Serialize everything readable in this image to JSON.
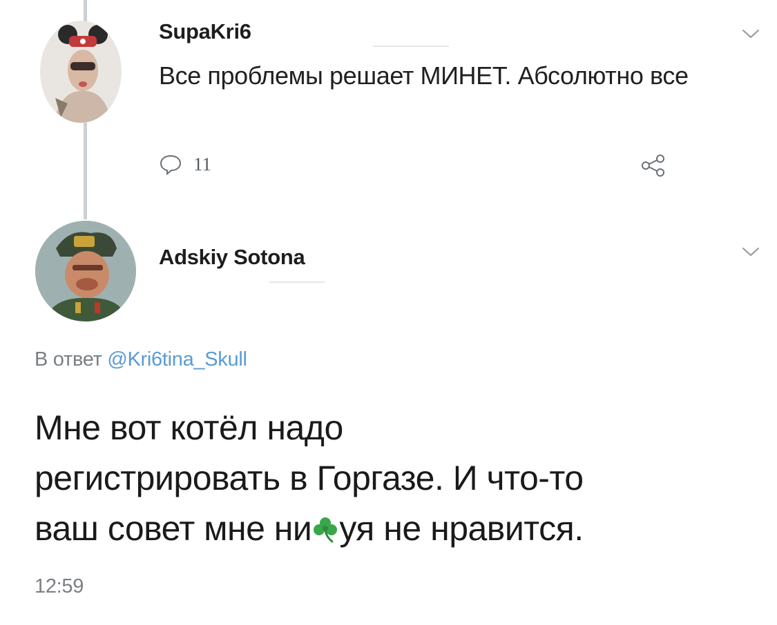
{
  "thread": {
    "parent": {
      "username": "SupaKri6",
      "text": "Все проблемы решает МИНЕТ. Абсолютно все",
      "reply_count": "11",
      "icons": {
        "reply": "reply-bubble-icon",
        "share": "share-icon",
        "menu": "chevron-down-icon"
      }
    },
    "reply": {
      "username": "Adskiy Sotona",
      "reply_prefix": "В ответ ",
      "reply_handle": "@Kri6tina_Skull",
      "text_line1": "Мне вот котёл надо",
      "text_line2": "регистрировать в Горгазе. И что-то",
      "text_line3a": "ваш совет мне ни",
      "text_line3b": "уя не нравится.",
      "emoji": "shamrock-icon",
      "time": "12:59",
      "icons": {
        "menu": "chevron-down-icon"
      }
    }
  },
  "colors": {
    "thread_line": "#c9d0d6",
    "handle": "#5a9bd4",
    "meta_text": "#7a7f85",
    "clover": "#3aa64a"
  }
}
